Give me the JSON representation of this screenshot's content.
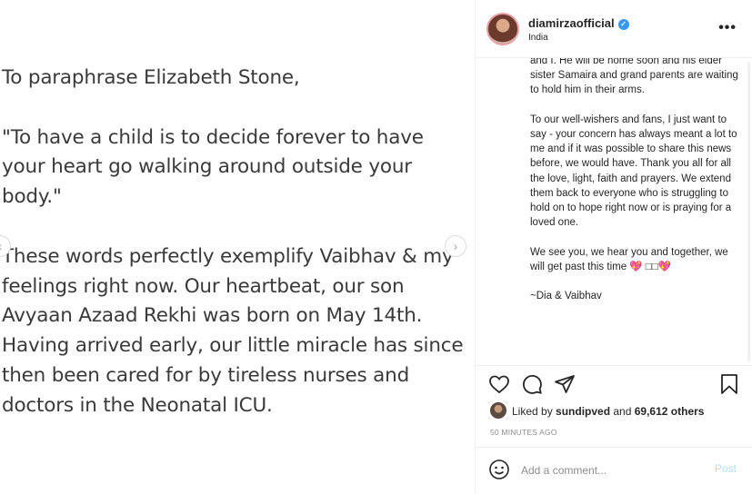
{
  "post": {
    "paragraphs": [
      "To paraphrase Elizabeth Stone,",
      "\"To have a child is to decide forever to have your heart go walking around outside your body.\"",
      "These words perfectly exemplify Vaibhav & my feelings right now. Our heartbeat, our son Avyaan Azaad Rekhi was born on May 14th. Having arrived early, our little miracle has since then been cared for by tireless nurses and doctors in the Neonatal ICU."
    ],
    "nav_prev": "‹",
    "nav_next": "›"
  },
  "header": {
    "username": "diamirzaofficial",
    "location": "India",
    "verified_mark": "✓",
    "more": "•••"
  },
  "caption": {
    "paragraphs": [
      "and I. He will be home soon and his elder sister Samaira and grand parents are waiting to hold him in their arms.",
      "To our well-wishers and fans, I just want to say - your concern has always meant a lot to me and if it was possible to share this news before, we would have. Thank you all for all the love, light, faith and prayers. We extend them back to everyone who is struggling to hold on to hope right now or is praying for a loved one.",
      "We see you, we hear you and together, we will get past this time 💖 □□💖",
      "~Dia & Vaibhav"
    ]
  },
  "actions": {
    "icons": [
      "heart-icon",
      "comment-icon",
      "share-icon",
      "bookmark-icon"
    ],
    "liked_by_prefix": "Liked by ",
    "liked_by_user": "sundipved",
    "liked_by_and": " and ",
    "liked_by_others": "69,612 others",
    "timestamp": "50 MINUTES AGO"
  },
  "comment": {
    "placeholder": "Add a comment...",
    "post_label": "Post"
  },
  "colors": {
    "accent": "#3897f0",
    "post_disabled": "#b2dffc",
    "border": "#efefef"
  }
}
